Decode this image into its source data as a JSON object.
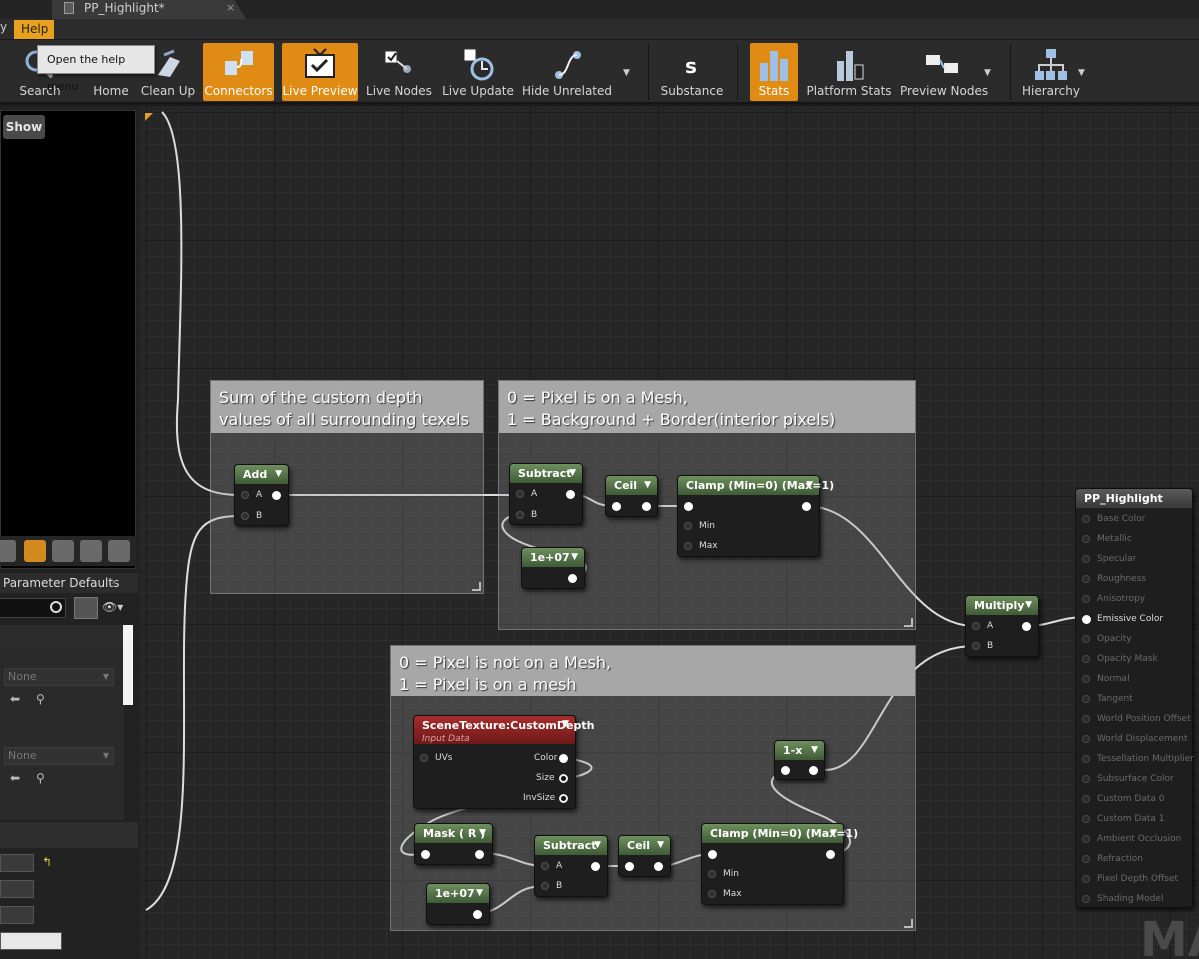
{
  "window": {
    "tab_title": "PP_Highlight*",
    "tab_close": "×"
  },
  "menu": {
    "help_label": "Help",
    "prev_fragment": "y"
  },
  "tooltip": {
    "text": "Open the help menu"
  },
  "toolbar": {
    "search": "Search",
    "home": "Home",
    "clean_up": "Clean Up",
    "connectors": "Connectors",
    "live_preview": "Live Preview",
    "live_nodes": "Live Nodes",
    "live_update": "Live Update",
    "hide_unrelated": "Hide Unrelated",
    "substance": "Substance",
    "stats": "Stats",
    "platform_stats": "Platform Stats",
    "preview_nodes": "Preview Nodes",
    "hierarchy": "Hierarchy",
    "dropdown_glyph": "▼"
  },
  "viewport": {
    "show_label": "Show"
  },
  "params": {
    "header": "Parameter Defaults",
    "header_close": "×",
    "none1": "None",
    "none2": "None"
  },
  "comments": {
    "sum": {
      "line1": "Sum of the custom depth",
      "line2": "values of all surrounding texels"
    },
    "pixel_mesh": {
      "line1": "0 = Pixel is on a Mesh,",
      "line2": "1 = Background + Border(interior pixels)"
    },
    "pixel_not_mesh": {
      "line1": "0 = Pixel is not on a Mesh,",
      "line2": "1 = Pixel is on a mesh"
    }
  },
  "nodes": {
    "add": {
      "title": "Add",
      "a": "A",
      "b": "B"
    },
    "subtract1": {
      "title": "Subtract",
      "a": "A",
      "b": "B"
    },
    "const1": {
      "title": "1e+07"
    },
    "ceil1": {
      "title": "Ceil"
    },
    "clamp1": {
      "title": "Clamp (Min=0) (Max=1)",
      "min": "Min",
      "max": "Max"
    },
    "multiply": {
      "title": "Multiply",
      "a": "A",
      "b": "B"
    },
    "scenetex": {
      "title": "SceneTexture:CustomDepth",
      "subtitle": "Input Data",
      "uvs": "UVs",
      "color": "Color",
      "size": "Size",
      "invsize": "InvSize"
    },
    "oneminus": {
      "title": "1-x"
    },
    "mask": {
      "title": "Mask ( R )"
    },
    "subtract2": {
      "title": "Subtract",
      "a": "A",
      "b": "B"
    },
    "ceil2": {
      "title": "Ceil"
    },
    "clamp2": {
      "title": "Clamp (Min=0) (Max=1)",
      "min": "Min",
      "max": "Max"
    },
    "const2": {
      "title": "1e+07"
    },
    "dropdown_glyph": "▼"
  },
  "material": {
    "title": "PP_Highlight",
    "pins": [
      "Base Color",
      "Metallic",
      "Specular",
      "Roughness",
      "Anisotropy",
      "Emissive Color",
      "Opacity",
      "Opacity Mask",
      "Normal",
      "Tangent",
      "World Position Offset",
      "World Displacement",
      "Tessellation Multiplier",
      "Subsurface Color",
      "Custom Data 0",
      "Custom Data 1",
      "Ambient Occlusion",
      "Refraction",
      "Pixel Depth Offset",
      "Shading Model"
    ],
    "active_pin": "Emissive Color"
  },
  "watermark": {
    "text": "MA"
  },
  "colors": {
    "accent": "#e08b13",
    "node_green": "#5a7a4c",
    "scenetex_red": "#8c2222"
  }
}
